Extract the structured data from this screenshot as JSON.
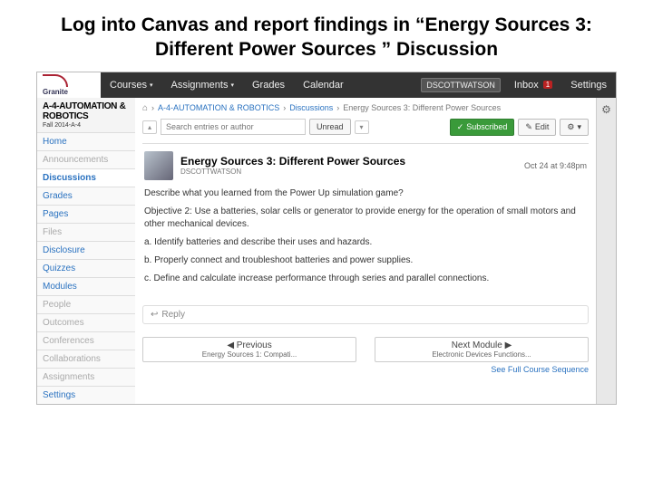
{
  "slide": {
    "title": "Log into Canvas and report findings in “Energy Sources 3: Different Power Sources ” Discussion"
  },
  "topnav": {
    "logo_text": "Granite",
    "items": [
      "Courses",
      "Assignments",
      "Grades",
      "Calendar"
    ],
    "user_btn": "DSCOTTWATSON",
    "inbox": "Inbox",
    "inbox_count": "1",
    "settings": "Settings"
  },
  "sidebar": {
    "course": "A-4-AUTOMATION & ROBOTICS",
    "sub": "Fall 2014-A-4",
    "items": [
      {
        "label": "Home",
        "muted": false
      },
      {
        "label": "Announcements",
        "muted": true
      },
      {
        "label": "Discussions",
        "muted": false,
        "active": true
      },
      {
        "label": "Grades",
        "muted": false
      },
      {
        "label": "Pages",
        "muted": false
      },
      {
        "label": "Files",
        "muted": true
      },
      {
        "label": "Disclosure",
        "muted": false
      },
      {
        "label": "Quizzes",
        "muted": false
      },
      {
        "label": "Modules",
        "muted": false
      },
      {
        "label": "People",
        "muted": true
      },
      {
        "label": "Outcomes",
        "muted": true
      },
      {
        "label": "Conferences",
        "muted": true
      },
      {
        "label": "Collaborations",
        "muted": true
      },
      {
        "label": "Assignments",
        "muted": true
      },
      {
        "label": "Settings",
        "muted": false
      }
    ]
  },
  "crumbs": {
    "home_icon": "⌂",
    "c1": "A-4-AUTOMATION & ROBOTICS",
    "c2": "Discussions",
    "c3": "Energy Sources 3: Different Power Sources"
  },
  "toolbar": {
    "search_placeholder": "Search entries or author",
    "unread": "Unread",
    "subscribed": "Subscribed",
    "edit": "Edit",
    "check": "✓",
    "pencil": "✎",
    "cog": "⚙",
    "chev_down": "▾",
    "chev_up": "▴"
  },
  "post": {
    "title": "Energy Sources 3: Different Power Sources",
    "author": "DSCOTTWATSON",
    "date": "Oct 24 at 9:48pm",
    "q": "Describe what you learned from the Power Up simulation game?",
    "obj": "Objective 2:  Use a batteries, solar cells or generator to provide energy for the operation of small motors and other mechanical devices.",
    "a": "a.  Identify batteries and describe their uses and hazards.",
    "b": "b.  Properly connect and troubleshoot batteries and power supplies.",
    "c": "c.  Define and calculate increase performance through series and parallel connections."
  },
  "reply": {
    "icon": "↩",
    "label": "Reply"
  },
  "pager": {
    "prev_top": "◀ Previous",
    "prev_sub": "Energy Sources 1: Compati...",
    "next_top": "Next Module ▶",
    "next_sub": "Electronic Devices Functions..."
  },
  "seq": "See Full Course Sequence",
  "gear_icon": "⚙"
}
